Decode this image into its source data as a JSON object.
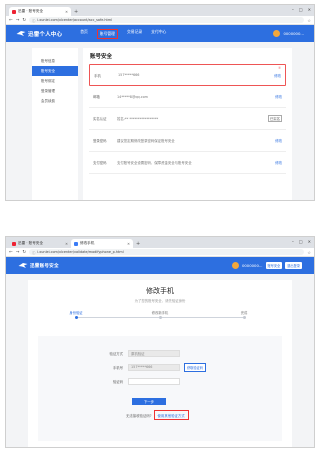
{
  "shot1": {
    "tab_title": "迅雷 · 账号安全",
    "address": "i.xunlei.com/xlcenter/account/acc_safe.html",
    "logo_text": "迅雷个人中心",
    "nav": [
      "首页",
      "账号管理",
      "交易记录",
      "支付中心"
    ],
    "mark1": "①",
    "mark2": "②",
    "username": "0000000...",
    "sidebar": [
      "账号信息",
      "账号安全",
      "账号绑定",
      "登录管理",
      "会员续费"
    ],
    "main_title": "账号安全",
    "rows": [
      {
        "label": "手机",
        "value": "157*****666",
        "action": "修改"
      },
      {
        "label": "邮箱",
        "value": "14*****8@qq.com",
        "action": "修改"
      },
      {
        "label": "实名认证",
        "value": "姓名:**  *****************",
        "action": "已实名"
      },
      {
        "label": "登录密码",
        "value": "建议您定期修改登录密码保证账号安全",
        "action": "修改"
      },
      {
        "label": "支付密码",
        "value": "支付账号安全设置密码，保障资金安全与账号安全",
        "action": "修改"
      }
    ]
  },
  "shot2": {
    "tabs": [
      "迅雷 · 账号安全",
      "修改手机"
    ],
    "address": "i.xunlei.com/xlcenter/validate/modifyphone_p.html",
    "logo_text": "迅雷账号安全",
    "username": "0000000...",
    "pill1": "账号安全",
    "pill2": "退出登录",
    "title": "修改手机",
    "subtitle": "为了您的账号安全，请先验证身份",
    "steps": [
      "身份验证",
      "修改新手机",
      "完成"
    ],
    "form": {
      "rows": [
        {
          "label": "验证方式",
          "value": "原机验证"
        },
        {
          "label": "手机号",
          "value": "157*****666"
        },
        {
          "label": "验证码",
          "value": ""
        }
      ],
      "sms_btn": "获取验证码",
      "next": "下一步",
      "other_label": "无法接收验证码?",
      "other_link": "使用其他验证方式"
    }
  }
}
